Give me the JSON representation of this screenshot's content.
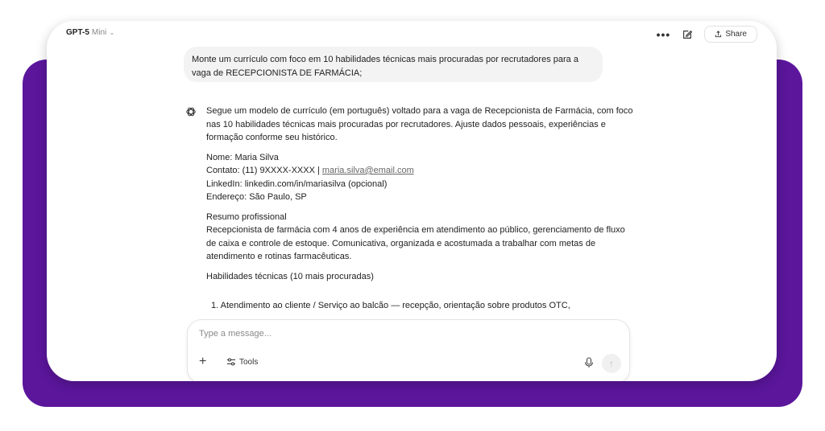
{
  "header": {
    "model_name": "GPT-5",
    "model_variant": "Mini",
    "more_label": "•••",
    "share_label": "Share"
  },
  "user_message": "Monte um currículo com foco em 10 habilidades técnicas mais procuradas por recrutadores para a vaga de RECEPCIONISTA DE FARMÁCIA;",
  "assistant": {
    "intro": "Segue um modelo de currículo (em português) voltado para a vaga de Recepcionista de Farmácia, com foco nas 10 habilidades técnicas mais procuradas por recrutadores. Ajuste dados pessoais, experiências e formação conforme seu histórico.",
    "name_line": "Nome: Maria Silva",
    "contact_prefix": "Contato: (11) 9XXXX-XXXX | ",
    "contact_email": "maria.silva@email.com",
    "linkedin_line": "LinkedIn: linkedin.com/in/mariasilva (opcional)",
    "address_line": "Endereço: São Paulo, SP",
    "summary_title": "Resumo profissional",
    "summary_text": "Recepcionista de farmácia com 4 anos de experiência em atendimento ao público, gerenciamento de fluxo de caixa e controle de estoque. Comunicativa, organizada e acostumada a trabalhar com metas de atendimento e rotinas farmacêuticas.",
    "skills_title": "Habilidades técnicas (10 mais procuradas)",
    "first_skill": "1. Atendimento ao cliente / Serviço ao balcão — recepção, orientação sobre produtos OTC,"
  },
  "composer": {
    "placeholder": "Type a message...",
    "plus_label": "+",
    "tools_label": "Tools"
  },
  "icons": {
    "chevron": "chevron-down-icon",
    "edit": "edit-icon",
    "share": "share-icon",
    "assistant": "openai-logo-icon",
    "tools": "sliders-icon",
    "mic": "microphone-icon",
    "send": "arrow-up-icon"
  },
  "colors": {
    "frame": "#5b169c",
    "bubble": "#f3f3f3"
  }
}
